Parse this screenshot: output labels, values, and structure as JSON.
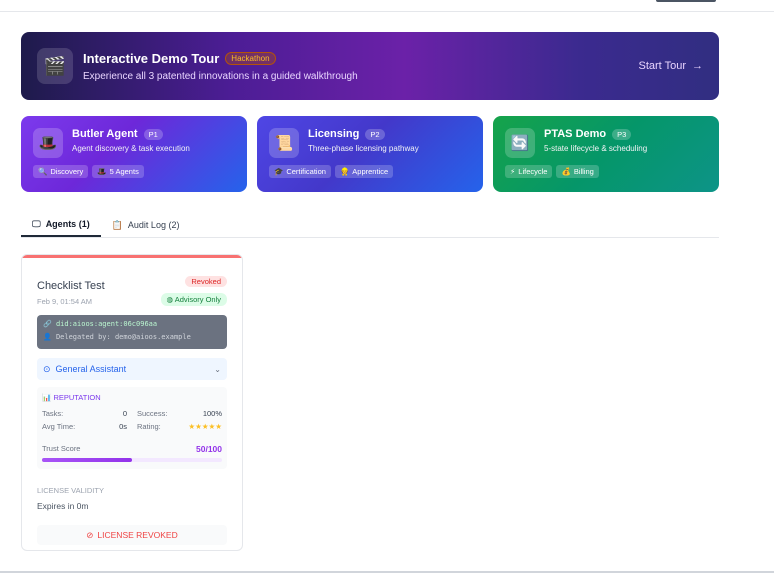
{
  "banner": {
    "title": "Interactive Demo Tour",
    "badge": "Hackathon",
    "subtitle": "Experience all 3 patented innovations in a guided walkthrough",
    "cta": "Start Tour",
    "icon": "clapperboard-icon"
  },
  "features": [
    {
      "title": "Butler Agent",
      "badge": "P1",
      "subtitle": "Agent discovery & task execution",
      "icon": "🎩",
      "chips": [
        {
          "icon": "🔍",
          "label": "Discovery"
        },
        {
          "icon": "🎩",
          "label": "5 Agents"
        }
      ]
    },
    {
      "title": "Licensing",
      "badge": "P2",
      "subtitle": "Three-phase licensing pathway",
      "icon": "📜",
      "chips": [
        {
          "icon": "🎓",
          "label": "Certification"
        },
        {
          "icon": "👷",
          "label": "Apprentice"
        }
      ]
    },
    {
      "title": "PTAS Demo",
      "badge": "P3",
      "subtitle": "5-state lifecycle & scheduling",
      "icon": "🔄",
      "chips": [
        {
          "icon": "⚡",
          "label": "Lifecycle"
        },
        {
          "icon": "💰",
          "label": "Billing"
        }
      ]
    }
  ],
  "tabs": [
    {
      "label": "Agents (1)",
      "icon": "monitor-icon"
    },
    {
      "label": "Audit Log (2)",
      "icon": "clipboard-icon"
    }
  ],
  "agent": {
    "name": "Checklist Test",
    "date": "Feb 9, 01:54 AM",
    "status": "Revoked",
    "mode": "Advisory Only",
    "did": "did:aioos:agent:06c096aa",
    "delegated": "Delegated by: demo@aioos.example",
    "role": "General Assistant",
    "reputation": {
      "title": "REPUTATION",
      "tasks_label": "Tasks:",
      "tasks": "0",
      "success_label": "Success:",
      "success": "100%",
      "avg_label": "Avg Time:",
      "avg": "0s",
      "rating_label": "Rating:",
      "rating": "★★★★★",
      "trust_label": "Trust Score",
      "trust": "50/100",
      "trust_value": 0.5
    },
    "license_label": "LICENSE VALIDITY",
    "license_value": "Expires in 0m",
    "revoked_label": "LICENSE REVOKED"
  },
  "colors": {
    "revoked_red": "#ef4444",
    "advisory_green": "#15803d",
    "trust_purple": "#9333ea"
  }
}
